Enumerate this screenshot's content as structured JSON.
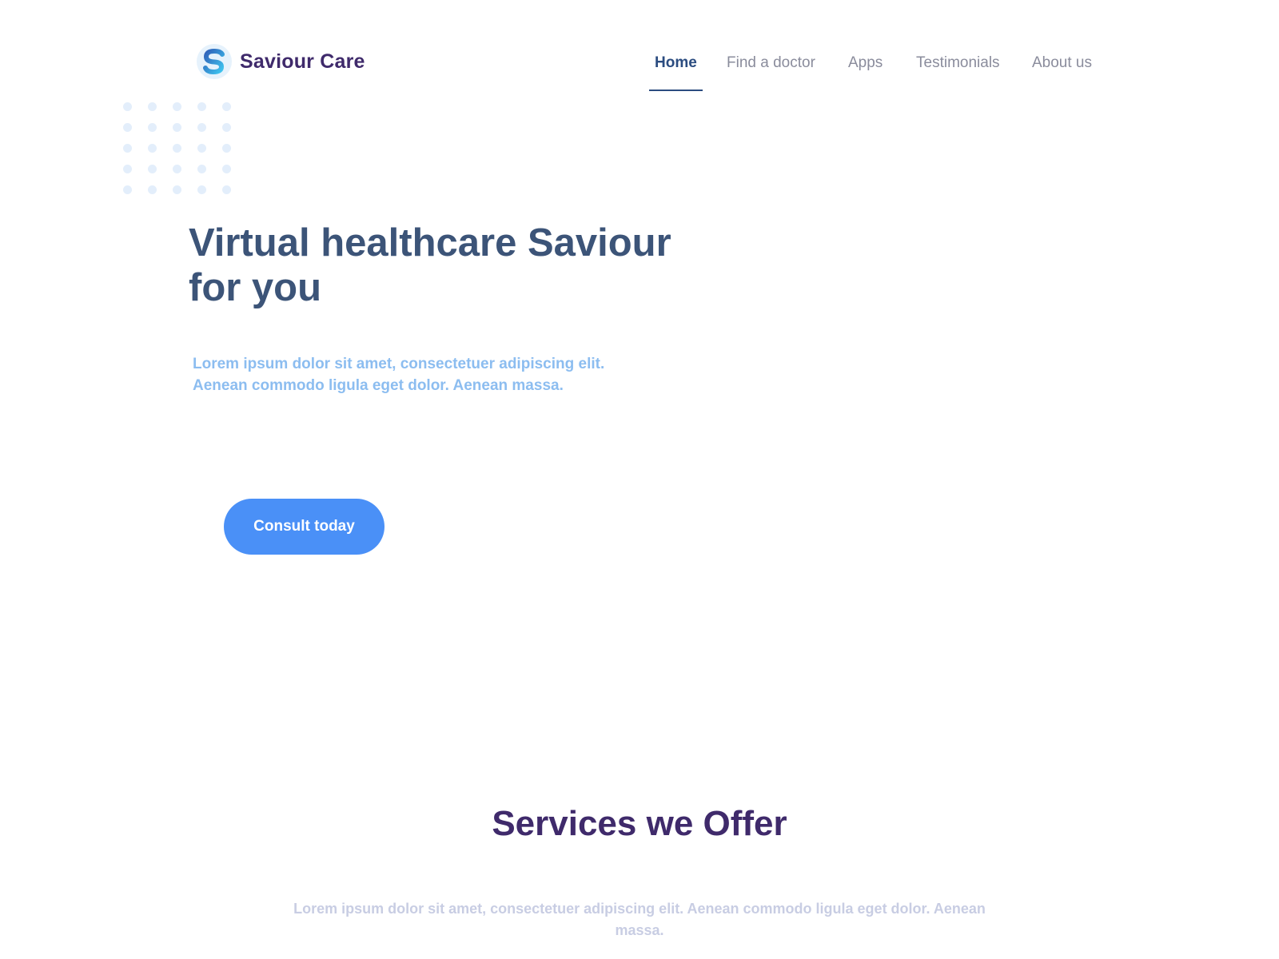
{
  "brand": {
    "name": "Saviour Care",
    "logo_icon": "s-logo-icon",
    "colors": {
      "primary": "#4a90f7",
      "heading": "#3c5478",
      "brand_text": "#3f2a6b",
      "accent_light": "#8cbdf0"
    }
  },
  "nav": {
    "items": [
      {
        "label": "Home",
        "active": true
      },
      {
        "label": "Find a doctor",
        "active": false
      },
      {
        "label": "Apps",
        "active": false
      },
      {
        "label": "Testimonials",
        "active": false
      },
      {
        "label": "About us",
        "active": false
      }
    ]
  },
  "hero": {
    "title_line1": "Virtual healthcare Saviour",
    "title_line2": "for you",
    "subtitle_line1": "Lorem ipsum dolor sit amet, consectetuer adipiscing elit.",
    "subtitle_line2": "Aenean commodo ligula eget dolor. Aenean massa.",
    "cta_label": "Consult today"
  },
  "services": {
    "title": "Services we Offer",
    "subtitle": "Lorem ipsum dolor sit amet, consectetuer adipiscing elit. Aenean commodo ligula eget dolor. Aenean massa."
  }
}
